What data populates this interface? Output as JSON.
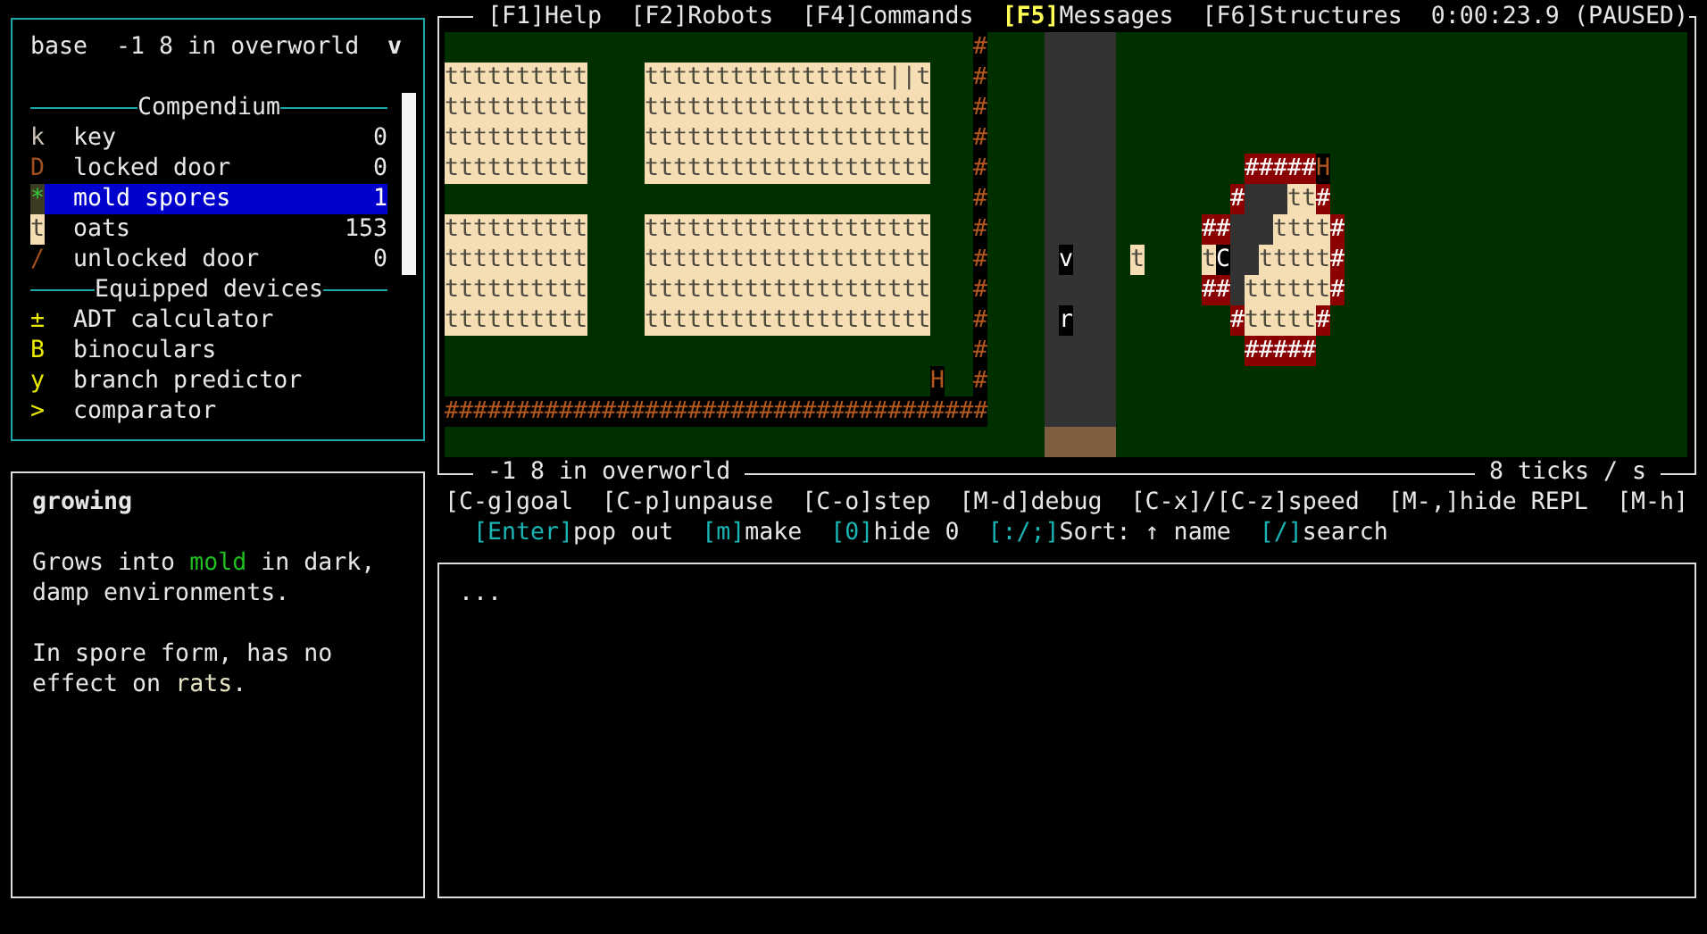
{
  "inventory": {
    "name": "base",
    "location": "-1 8 in overworld",
    "toggle": "v",
    "compendium": {
      "title": "Compendium",
      "items": [
        {
          "glyph": "k",
          "kind": "item",
          "name": "key",
          "count": "0",
          "selected": false
        },
        {
          "glyph": "D",
          "kind": "structure",
          "name": "locked door",
          "count": "0",
          "selected": false
        },
        {
          "glyph": "*",
          "kind": "fungus",
          "name": "mold spores",
          "count": "1",
          "selected": true
        },
        {
          "glyph": "t",
          "kind": "crop",
          "name": "oats",
          "count": "153",
          "selected": false
        },
        {
          "glyph": "/",
          "kind": "structure",
          "name": "unlocked door",
          "count": "0",
          "selected": false
        }
      ]
    },
    "devices": {
      "title": "Equipped devices",
      "items": [
        {
          "glyph": "±",
          "name": "ADT calculator"
        },
        {
          "glyph": "B",
          "name": "binoculars"
        },
        {
          "glyph": "y",
          "name": "branch predictor"
        },
        {
          "glyph": ">",
          "name": "comparator"
        }
      ]
    }
  },
  "description": {
    "title": "growing",
    "paragraphs": [
      {
        "parts": [
          {
            "kind": "plain",
            "text": "Grows into "
          },
          {
            "kind": "entity",
            "text": "mold"
          },
          {
            "kind": "plain",
            "text": " in dark, damp environments."
          }
        ]
      },
      {
        "parts": [
          {
            "kind": "plain",
            "text": "In spore form, has no effect on "
          },
          {
            "kind": "item",
            "text": "rats"
          },
          {
            "kind": "plain",
            "text": "."
          }
        ]
      }
    ]
  },
  "world": {
    "menu": [
      {
        "key": "[F1]",
        "label": "Help",
        "highlighted": false
      },
      {
        "key": "[F2]",
        "label": "Robots",
        "highlighted": false
      },
      {
        "key": "[F4]",
        "label": "Commands",
        "highlighted": false
      },
      {
        "key": "[F5]",
        "label": "Messages",
        "highlighted": true
      },
      {
        "key": "[F6]",
        "label": "Structures",
        "highlighted": false
      }
    ],
    "clock": "0:00:23.9 (PAUSED)",
    "location": "-1 8 in overworld",
    "speed": "8 ticks / s",
    "features": [
      {
        "kind": "wall",
        "text": "############"
      },
      {
        "kind": "crops",
        "rows": [
          "tttttttttt",
          "tttttttttt",
          "tttttttttt",
          "tttttttttt"
        ]
      },
      {
        "kind": "crops",
        "rows": [
          "ttttttttttttttttt||t",
          "tttttttttttttttttttt",
          "tttttttttttttttttttt",
          "tttttttttttttttttttt"
        ]
      },
      {
        "kind": "brick",
        "text": "#####"
      },
      {
        "kind": "gate",
        "text": "H"
      },
      {
        "kind": "brick",
        "text": "#"
      },
      {
        "kind": "crops",
        "text": "tt"
      },
      {
        "kind": "brick",
        "text": "#"
      },
      {
        "kind": "crops",
        "rows": [
          "tttttttttt",
          "tttttttttt",
          "tttttttttt",
          "tttttttttt"
        ]
      },
      {
        "kind": "crops",
        "rows": [
          "tttttttttttttttttttt",
          "tttttttttttttttttttt",
          "tttttttttttttttttttt",
          "tttttttttttttttttttt"
        ]
      },
      {
        "kind": "brick",
        "text": "##"
      },
      {
        "kind": "crops",
        "text": "tttt"
      },
      {
        "kind": "brick",
        "text": "#"
      },
      {
        "kind": "robot",
        "text": "v"
      },
      {
        "kind": "crops",
        "text": "t"
      },
      {
        "kind": "crops",
        "text": "t"
      },
      {
        "kind": "robot",
        "text": "C"
      },
      {
        "kind": "crops",
        "text": "ttttt"
      },
      {
        "kind": "brick",
        "text": "#"
      },
      {
        "kind": "brick",
        "text": "##"
      },
      {
        "kind": "crops",
        "text": "tttttt"
      },
      {
        "kind": "brick",
        "text": "#"
      },
      {
        "kind": "robot",
        "text": "r"
      },
      {
        "kind": "brick",
        "text": "#"
      },
      {
        "kind": "crops",
        "text": "ttttt"
      },
      {
        "kind": "brick",
        "text": "#"
      },
      {
        "kind": "brick",
        "text": "#####"
      },
      {
        "kind": "gate",
        "text": "H"
      },
      {
        "kind": "wall",
        "text": "######################################"
      }
    ]
  },
  "hint_lines": [
    {
      "kind": "global",
      "items": [
        {
          "key": "[C-g]",
          "label": "goal"
        },
        {
          "key": "[C-p]",
          "label": "unpause"
        },
        {
          "key": "[C-o]",
          "label": "step"
        },
        {
          "key": "[M-d]",
          "label": "debug"
        },
        {
          "key": "[C-x]/[C-z]",
          "label": "speed"
        },
        {
          "key": "[M-,]",
          "label": "hide REPL"
        },
        {
          "key": "[M-h]"
        }
      ]
    },
    {
      "kind": "context",
      "items": [
        {
          "key": "[Enter]",
          "label": "pop out"
        },
        {
          "key": "[m]",
          "label": "make"
        },
        {
          "key": "[0]",
          "label": "hide 0"
        },
        {
          "key": "[:/;]",
          "label": "Sort: ↑ name"
        },
        {
          "key": "[/]",
          "label": "search"
        }
      ]
    }
  ],
  "repl": {
    "output": "..."
  }
}
